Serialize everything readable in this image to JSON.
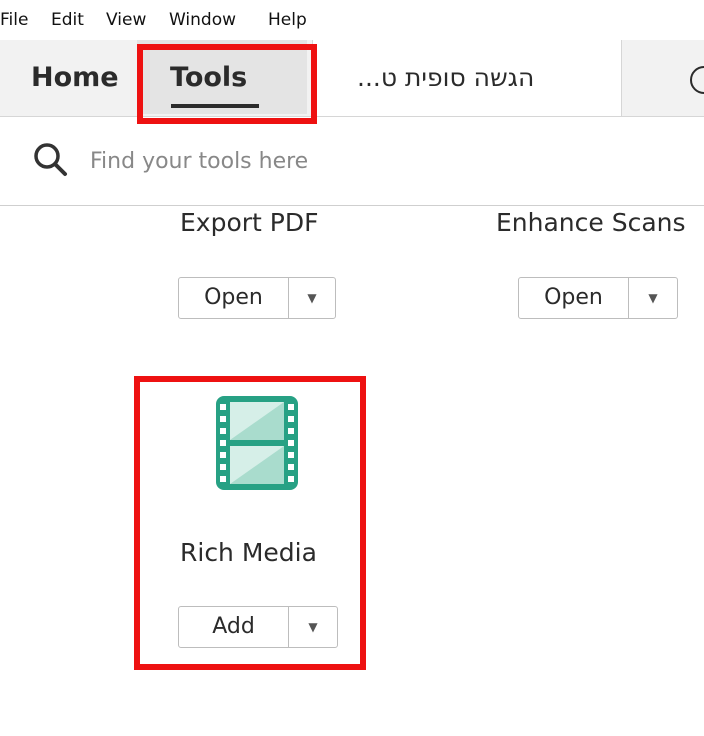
{
  "menu": {
    "items": [
      "File",
      "Edit",
      "View",
      "Window",
      "Help"
    ]
  },
  "tabs": {
    "home_label": "Home",
    "tools_label": "Tools",
    "document_label": "הגשה סופית ט..."
  },
  "search": {
    "placeholder": "Find your tools here"
  },
  "tools": [
    {
      "name": "Export PDF",
      "button_label": "Open"
    },
    {
      "name": "Enhance Scans",
      "button_label": "Open"
    },
    {
      "name": "Rich Media",
      "button_label": "Add",
      "icon": "film-strip-icon"
    }
  ],
  "colors": {
    "highlight_border": "#ee1111",
    "rich_media_icon": "#27a184"
  }
}
